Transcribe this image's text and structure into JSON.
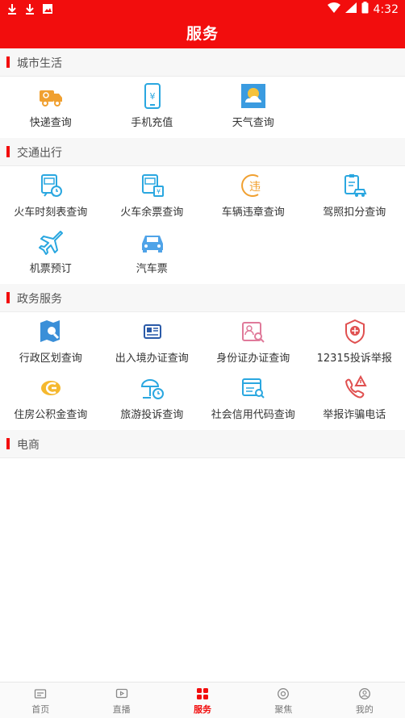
{
  "status_bar": {
    "time": "4:32"
  },
  "header": {
    "title": "服务"
  },
  "sections": [
    {
      "title": "城市生活",
      "items": [
        {
          "label": "快递查询",
          "icon": "express-truck-icon"
        },
        {
          "label": "手机充值",
          "icon": "phone-recharge-icon"
        },
        {
          "label": "天气查询",
          "icon": "weather-icon"
        }
      ]
    },
    {
      "title": "交通出行",
      "items": [
        {
          "label": "火车时刻表查询",
          "icon": "train-schedule-icon"
        },
        {
          "label": "火车余票查询",
          "icon": "train-ticket-icon"
        },
        {
          "label": "车辆违章查询",
          "icon": "violation-icon"
        },
        {
          "label": "驾照扣分查询",
          "icon": "license-points-icon"
        },
        {
          "label": "机票预订",
          "icon": "airplane-icon"
        },
        {
          "label": "汽车票",
          "icon": "bus-ticket-icon"
        }
      ]
    },
    {
      "title": "政务服务",
      "items": [
        {
          "label": "行政区划查询",
          "icon": "map-search-icon"
        },
        {
          "label": "出入境办证查询",
          "icon": "passport-icon"
        },
        {
          "label": "身份证办证查询",
          "icon": "id-card-icon"
        },
        {
          "label": "12315投诉举报",
          "icon": "complaint-badge-icon"
        },
        {
          "label": "住房公积金查询",
          "icon": "housing-fund-icon"
        },
        {
          "label": "旅游投诉查询",
          "icon": "travel-complaint-icon"
        },
        {
          "label": "社会信用代码查询",
          "icon": "credit-code-icon"
        },
        {
          "label": "举报诈骗电话",
          "icon": "fraud-phone-icon"
        }
      ]
    },
    {
      "title": "电商",
      "items": []
    }
  ],
  "bottom_nav": [
    {
      "label": "首页",
      "icon": "home-icon"
    },
    {
      "label": "直播",
      "icon": "live-icon"
    },
    {
      "label": "服务",
      "icon": "services-icon",
      "active": true
    },
    {
      "label": "聚焦",
      "icon": "focus-icon"
    },
    {
      "label": "我的",
      "icon": "profile-icon"
    }
  ],
  "colors": {
    "brand": "#f20d0d",
    "icon_blue": "#2aa7e0",
    "icon_orange": "#f0a030"
  }
}
